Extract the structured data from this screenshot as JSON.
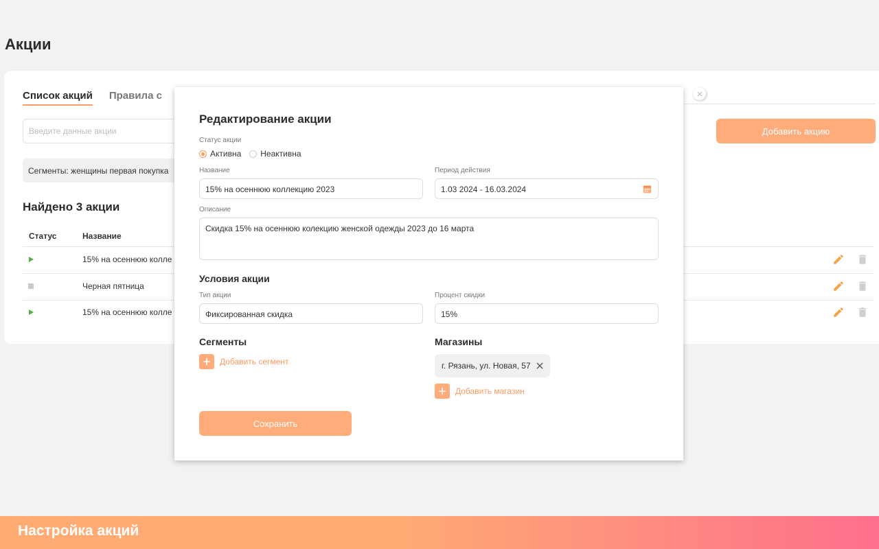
{
  "page": {
    "title": "Акции"
  },
  "tabs": [
    {
      "label": "Список акций",
      "active": true
    },
    {
      "label": "Правила с"
    }
  ],
  "search": {
    "placeholder": "Введите данные акции"
  },
  "add_promo_button": "Добавить акцию",
  "segment_chip": "Сегменты: женщины первая покупка",
  "found_text": "Найдено 3 акции",
  "table": {
    "headers": {
      "status": "Статус",
      "name": "Название"
    },
    "rows": [
      {
        "status": "active",
        "status_icon": "play-icon",
        "name": "15% на осеннюю колле"
      },
      {
        "status": "inactive",
        "status_icon": "stop-icon",
        "name": "Черная пятница"
      },
      {
        "status": "active",
        "status_icon": "play-icon",
        "name": "15% на осеннюю колле"
      }
    ],
    "row_actions": [
      "edit-icon",
      "trash-icon"
    ]
  },
  "modal": {
    "title": "Редактирование акции",
    "status_label": "Статус акции",
    "status_options": [
      "Активна",
      "Неактивна"
    ],
    "status_selected": "Активна",
    "name_label": "Название",
    "name_value": "15% на осеннюю коллекцию 2023",
    "period_label": "Период действия",
    "period_value": "1.03 2024 - 16.03.2024",
    "description_label": "Описание",
    "description_value": "Скидка 15% на осеннюю колекцию женской одежды 2023 до 16 марта",
    "conditions_title": "Условия акции",
    "type_label": "Тип акции",
    "type_value": "Фиксированная скидка",
    "discount_label": "Процент скидки",
    "discount_value": "15%",
    "segments_title": "Сегменты",
    "add_segment": "Добавить сегмент",
    "stores_title": "Магазины",
    "stores": [
      "г. Рязань, ул. Новая, 57"
    ],
    "add_store": "Добавить магазин",
    "save_button": "Сохранить"
  },
  "footer": {
    "title": "Настройка акций"
  },
  "colors": {
    "accent": "#ff9a62",
    "button": "#ffab7a",
    "active_status": "#52b044",
    "inactive_status": "#c9c9c9",
    "footer_gradient": [
      "#ffab73",
      "#ff6f8c"
    ]
  }
}
